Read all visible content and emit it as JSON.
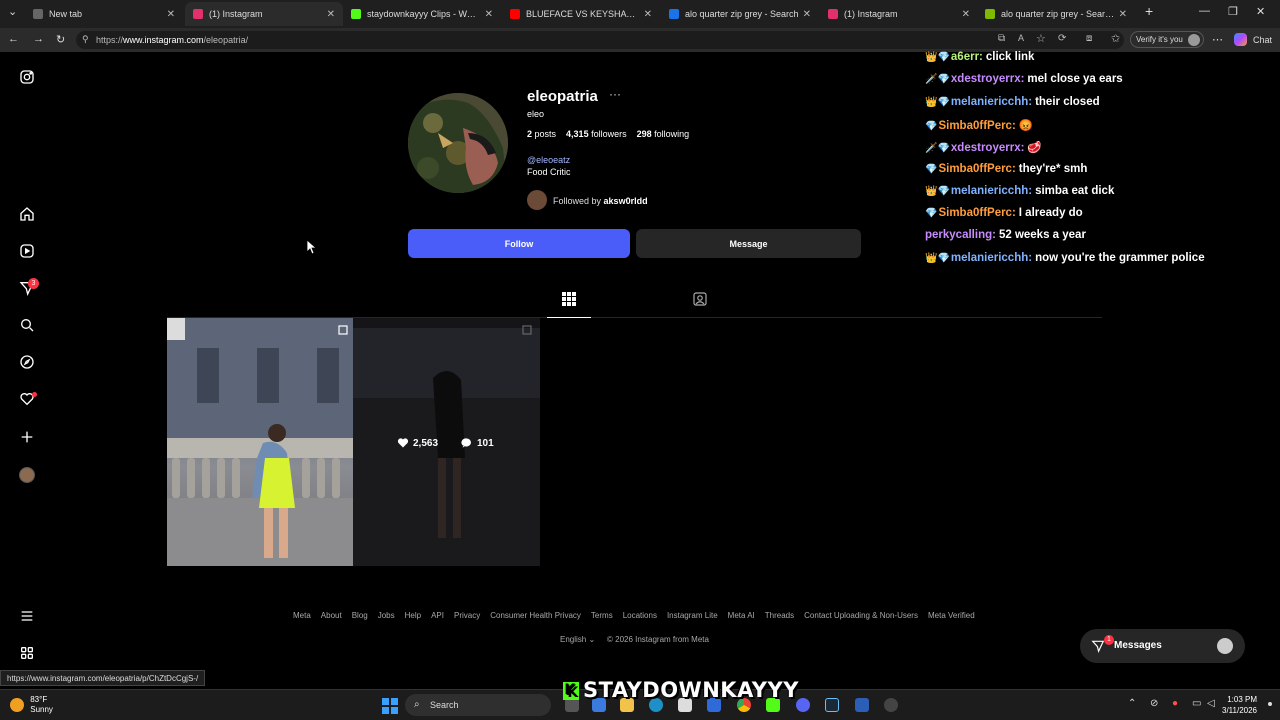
{
  "browser": {
    "tabs": [
      {
        "label": "New tab",
        "color": "#666666"
      },
      {
        "label": "(1) Instagram",
        "color": "#e1306c",
        "active": true
      },
      {
        "label": "staydownkayyy Clips - Watch Live",
        "color": "#53fc18"
      },
      {
        "label": "BLUEFACE VS KEYSHAWN DAVIS (",
        "color": "#ff0000"
      },
      {
        "label": "alo quarter zip grey - Search",
        "color": "#1a73e8"
      },
      {
        "label": "(1) Instagram",
        "color": "#e1306c"
      },
      {
        "label": "alo quarter zip grey - Search Shop",
        "color": "#7fba00"
      }
    ],
    "url_prefix": "https://",
    "url_host": "www.instagram.com",
    "url_path": "/eleopatria/",
    "verify_label": "Verify it's you",
    "chat_label": "Chat"
  },
  "profile": {
    "username": "eleopatria",
    "more_icon": "ellipsis-icon",
    "full_name": "eleo",
    "posts_count": "2",
    "posts_label": "posts",
    "followers_count": "4,315",
    "followers_label": "followers",
    "following_count": "298",
    "following_label": "following",
    "handle_link": "@eleoeatz",
    "bio": "Food Critic",
    "followed_by_prefix": "Followed by",
    "followed_by_user": "aksw0rldd",
    "follow_label": "Follow",
    "message_label": "Message"
  },
  "posts": [
    {
      "likes": "",
      "comments": ""
    },
    {
      "likes": "2,563",
      "comments": "101"
    }
  ],
  "sidebar": {
    "notifications_badge": "3"
  },
  "footer": {
    "links": [
      "Meta",
      "About",
      "Blog",
      "Jobs",
      "Help",
      "API",
      "Privacy",
      "Consumer Health Privacy",
      "Terms",
      "Locations",
      "Instagram Lite",
      "Meta AI",
      "Threads",
      "Contact Uploading & Non-Users",
      "Meta Verified"
    ],
    "language": "English",
    "copyright": "© 2026 Instagram from Meta"
  },
  "messages_pill": {
    "label": "Messages",
    "badge": "1"
  },
  "chat_overlay": [
    {
      "icons": "👑💎",
      "name": "a6err:",
      "name_color": "#b9f27c",
      "text": "click link"
    },
    {
      "icons": "🗡️💎",
      "name": "xdestroyerrx:",
      "name_color": "#c78bff",
      "text": "mel close ya ears"
    },
    {
      "icons": "👑💎",
      "name": "melaniericchh:",
      "name_color": "#7fb2ff",
      "text": "their closed"
    },
    {
      "icons": "💎",
      "name": "Simba0ffPerc:",
      "name_color": "#ff9e3d",
      "text": "😡"
    },
    {
      "icons": "🗡️💎",
      "name": "xdestroyerrx:",
      "name_color": "#c78bff",
      "text": "🥩"
    },
    {
      "icons": "💎",
      "name": "Simba0ffPerc:",
      "name_color": "#ff9e3d",
      "text": "they're* smh"
    },
    {
      "icons": "👑💎",
      "name": "melaniericchh:",
      "name_color": "#7fb2ff",
      "text": "simba eat dick"
    },
    {
      "icons": "💎",
      "name": "Simba0ffPerc:",
      "name_color": "#ff9e3d",
      "text": "I already do"
    },
    {
      "icons": "",
      "name": "perkycalling:",
      "name_color": "#c78bff",
      "text": "52 weeks a year"
    },
    {
      "icons": "👑💎",
      "name": "melaniericchh:",
      "name_color": "#7fb2ff",
      "text": "now you're the grammer police"
    }
  ],
  "status_url": "https://www.instagram.com/eleopatria/p/ChZtDcCgjS-/",
  "watermark": "STAYDOWNKAYYY",
  "taskbar": {
    "temperature": "83°F",
    "condition": "Sunny",
    "search_label": "Search",
    "time": "1:03 PM",
    "date": "3/11/2026"
  }
}
